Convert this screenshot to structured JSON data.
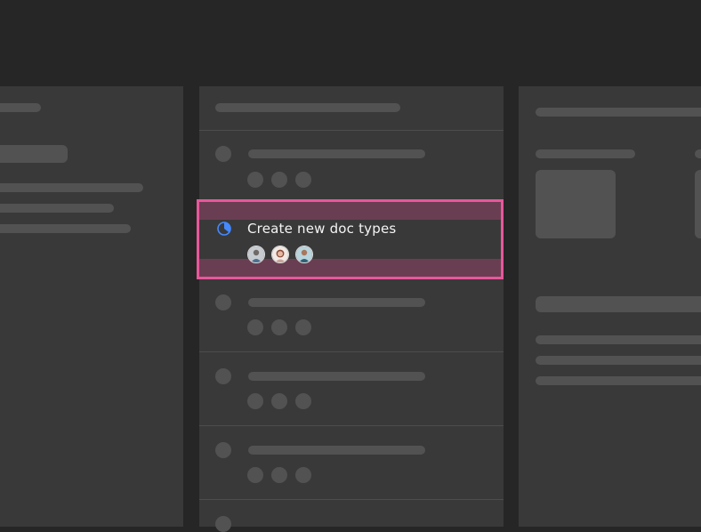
{
  "task": {
    "title": "Create new doc types",
    "status_icon": "in-progress-icon",
    "assignees": [
      {
        "name": "avatar-1"
      },
      {
        "name": "avatar-2"
      },
      {
        "name": "avatar-3"
      }
    ]
  },
  "colors": {
    "background": "#262626",
    "panel": "#393939",
    "placeholder": "#525252",
    "highlight_border": "#e8579a",
    "status_blue": "#4589ff",
    "text": "#f4f4f4"
  }
}
